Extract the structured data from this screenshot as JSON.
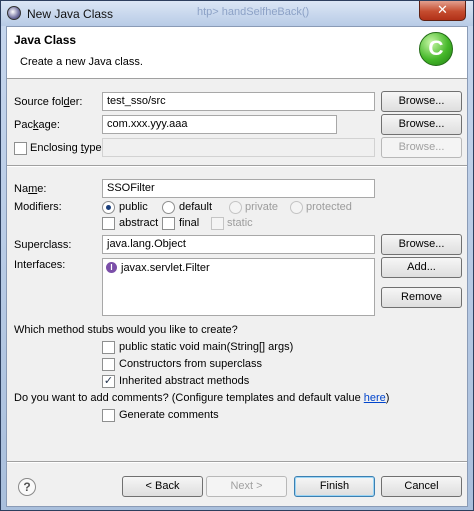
{
  "window": {
    "title": "New Java Class",
    "title_ghost": "htp> handSelfheBack()",
    "close_glyph": "✕"
  },
  "banner": {
    "title": "Java Class",
    "description": "Create a new Java class.",
    "icon_letter": "C"
  },
  "source_folder": {
    "label": "Source fol",
    "label_mn": "d",
    "label_rest": "er:",
    "value": "test_sso/src",
    "browse": "Browse..."
  },
  "package": {
    "label": "Pac",
    "label_mn": "k",
    "label_rest": "age:",
    "value": "com.xxx.yyy.aaa",
    "browse": "Browse..."
  },
  "enclosing": {
    "label": "Enclosing ",
    "label_mn": "t",
    "label_rest": "ype:",
    "value": "",
    "browse": "Browse..."
  },
  "name": {
    "label": "Na",
    "label_mn": "m",
    "label_rest": "e:",
    "value": "SSOFilter"
  },
  "modifiers": {
    "label": "Modifiers:",
    "options": [
      {
        "label": "public",
        "selected": true,
        "enabled": true
      },
      {
        "label": "default",
        "selected": false,
        "enabled": true
      },
      {
        "label": "private",
        "selected": false,
        "enabled": false
      },
      {
        "label": "protected",
        "selected": false,
        "enabled": false
      }
    ],
    "checks": [
      {
        "label": "abstract",
        "checked": false,
        "enabled": true
      },
      {
        "label": "final",
        "checked": false,
        "enabled": true
      },
      {
        "label": "static",
        "checked": false,
        "enabled": false
      }
    ]
  },
  "superclass": {
    "label": "Superclass:",
    "value": "java.lang.Object",
    "browse": "Browse..."
  },
  "interfaces": {
    "label": "Interfaces:",
    "items": [
      "javax.servlet.Filter"
    ],
    "add": "Add...",
    "remove": "Remove"
  },
  "stubs": {
    "question": "Which method stubs would you like to create?",
    "options": [
      {
        "label": "public static void main(String[] args)",
        "checked": false
      },
      {
        "label": "Constructors from superclass",
        "checked": false
      },
      {
        "label": "Inherited abstract methods",
        "checked": true
      }
    ]
  },
  "comments": {
    "question": "Do you want to add comments? (Configure templates and default value ",
    "link": "here",
    "question_end": ")",
    "option": {
      "label": "Generate comments",
      "checked": false
    }
  },
  "footer": {
    "help": "?",
    "back": "< Back",
    "next": "Next >",
    "finish": "Finish",
    "cancel": "Cancel"
  },
  "colors": {
    "title_bar": "#c7d7ee",
    "close_button": "#c54c2f",
    "dialog_bg": "#f0f0f0",
    "link": "#0044cc",
    "class_icon": "#46b82a",
    "interface_icon": "#7b4fa9"
  }
}
